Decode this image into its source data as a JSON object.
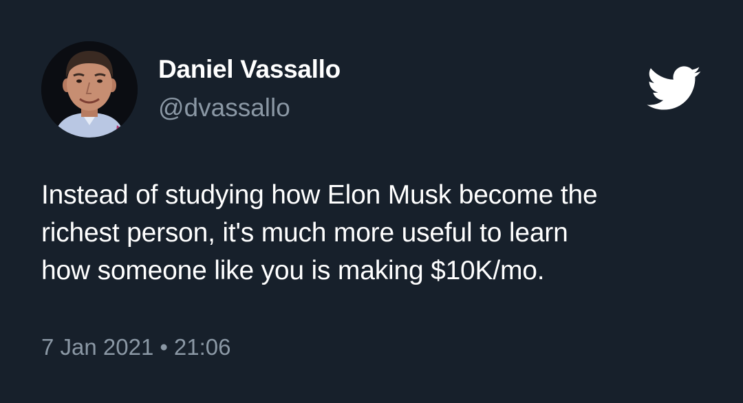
{
  "author": {
    "name": "Daniel Vassallo",
    "handle": "@dvassallo"
  },
  "icons": {
    "avatar": "profile-photo",
    "logo": "twitter-bird-icon"
  },
  "tweet": {
    "lines": [
      "Instead of studying how Elon Musk become the",
      "richest person, it's much more useful to learn",
      "how someone like you is making $10K/mo."
    ]
  },
  "meta": {
    "date": "7 Jan 2021",
    "separator": "•",
    "time": "21:06"
  },
  "colors": {
    "background": "#17202b",
    "primary_text": "#ffffff",
    "secondary_text": "#8b98a5"
  }
}
